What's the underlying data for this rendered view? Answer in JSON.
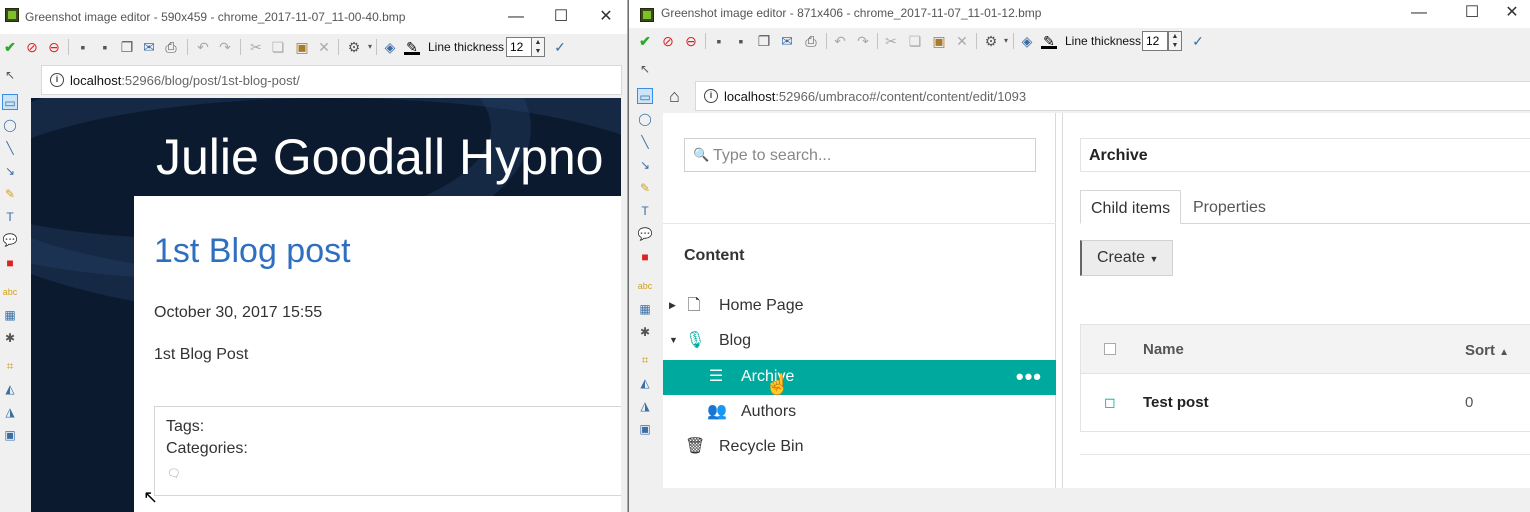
{
  "window1": {
    "title": "Greenshot image editor - 590x459 - chrome_2017-11-07_11-00-40.bmp",
    "controls": {
      "minimize": "—",
      "maximize": "☐",
      "close": "✕"
    },
    "toolbar": {
      "line_thickness_label": "Line thickness",
      "line_thickness_value": "12"
    },
    "address": {
      "host": "localhost",
      "rest": ":52966/blog/post/1st-blog-post/"
    },
    "page": {
      "site_title": "Julie Goodall Hypno",
      "post_title": "1st Blog post",
      "post_date": "October 30, 2017 15:55",
      "post_body": "1st Blog Post",
      "tags_label": "Tags:",
      "categories_label": "Categories:"
    }
  },
  "window2": {
    "title": "Greenshot image editor - 871x406 - chrome_2017-11-07_11-01-12.bmp",
    "controls": {
      "minimize": "—",
      "maximize": "☐",
      "close": "✕"
    },
    "toolbar": {
      "line_thickness_label": "Line thickness",
      "line_thickness_value": "12"
    },
    "address": {
      "host": "localhost",
      "rest": ":52966/umbraco#/content/content/edit/1093"
    },
    "umbraco": {
      "search_placeholder": "Type to search...",
      "section_title": "Content",
      "tree": [
        {
          "label": "Home Page",
          "icon": "document-icon",
          "level": 0,
          "caret": "right",
          "selected": false
        },
        {
          "label": "Blog",
          "icon": "microphone-icon",
          "level": 0,
          "caret": "down",
          "selected": false
        },
        {
          "label": "Archive",
          "icon": "list-icon",
          "level": 1,
          "caret": "",
          "selected": true
        },
        {
          "label": "Authors",
          "icon": "users-icon",
          "level": 1,
          "caret": "",
          "selected": false
        },
        {
          "label": "Recycle Bin",
          "icon": "trash-icon",
          "level": 0,
          "caret": "",
          "selected": false
        }
      ],
      "node_name": "Archive",
      "tabs": {
        "child_items": "Child items",
        "properties": "Properties"
      },
      "create_label": "Create",
      "list": {
        "col_name": "Name",
        "col_sort": "Sort",
        "rows": [
          {
            "name": "Test post",
            "sort": "0"
          }
        ]
      }
    }
  },
  "colors": {
    "accent": "#00a99d",
    "link_blue": "#2f6fc0",
    "hero_bg": "#0b1a2e"
  }
}
